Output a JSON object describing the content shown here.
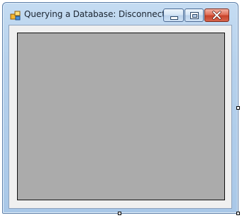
{
  "window": {
    "title": "Querying a Database: Disconnected"
  },
  "icons": {
    "app": "windows-form-icon",
    "minimize": "minimize-icon",
    "maximize": "maximize-icon",
    "close": "close-icon"
  },
  "colors": {
    "title_bar": "#b6d1ec",
    "close_button": "#c8432a",
    "client_area": "#f0f0f0",
    "grid_background": "#ababab"
  }
}
